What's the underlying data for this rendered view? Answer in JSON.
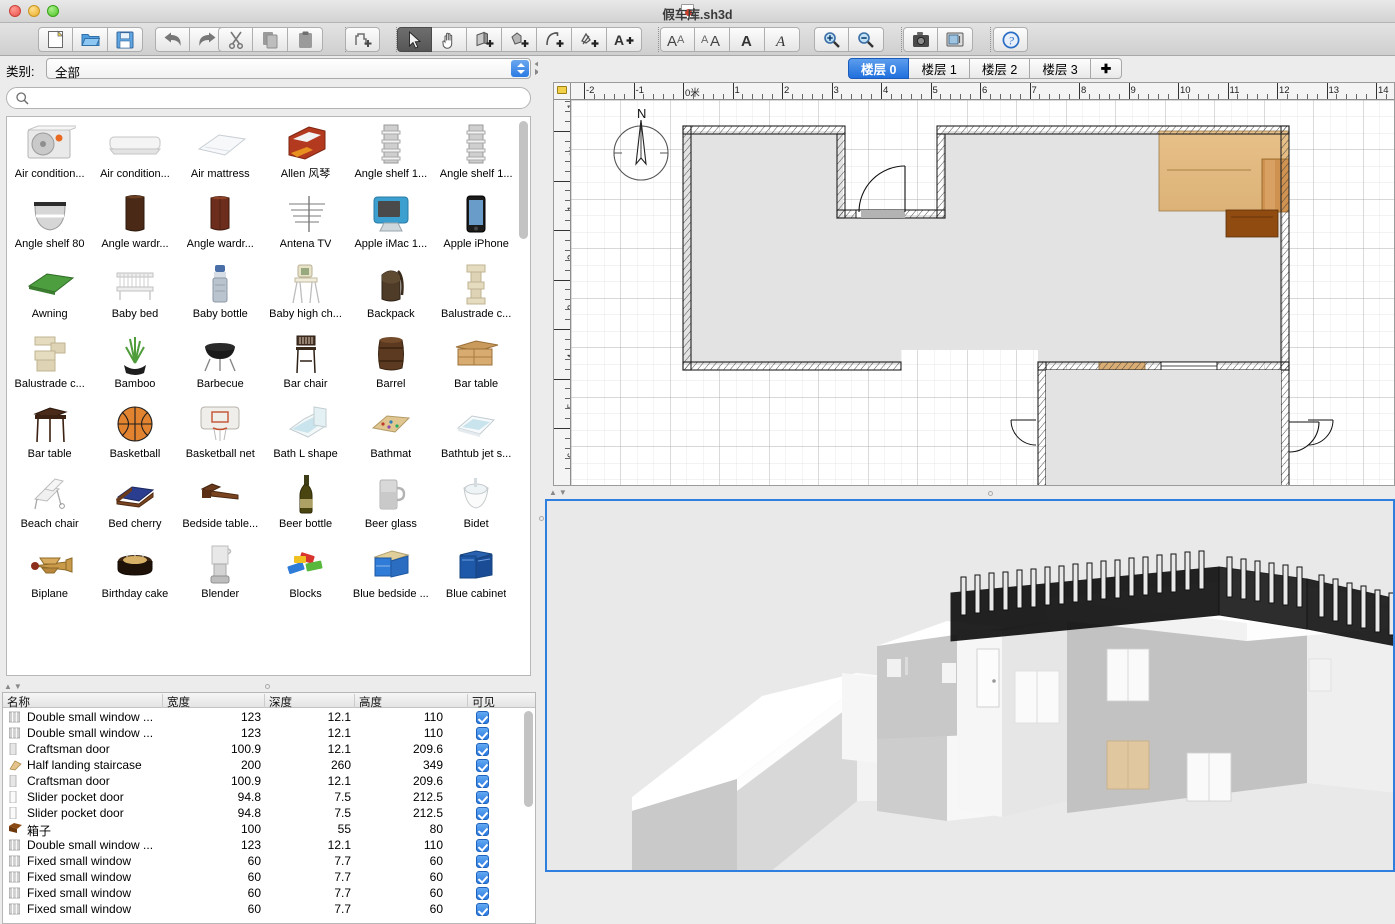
{
  "window": {
    "title": "假车库.sh3d",
    "title_icon": "document-icon",
    "controls": [
      "close",
      "minimize",
      "zoom"
    ]
  },
  "toolbar": {
    "groups": [
      {
        "name": "file",
        "buttons": [
          {
            "name": "new-home-button",
            "icon": "new-document-icon",
            "label": "新建"
          },
          {
            "name": "open-button",
            "icon": "open-folder-icon",
            "label": "打开"
          },
          {
            "name": "save-button",
            "icon": "save-disk-icon",
            "label": "保存"
          }
        ]
      },
      {
        "name": "edit",
        "buttons": [
          {
            "name": "undo-button",
            "icon": "undo-arrow-icon",
            "label": "撤销"
          },
          {
            "name": "redo-button",
            "icon": "redo-arrow-icon",
            "label": "重做"
          }
        ]
      },
      {
        "name": "clipboard",
        "buttons": [
          {
            "name": "cut-button",
            "icon": "scissors-icon",
            "label": "剪切"
          },
          {
            "name": "copy-button",
            "icon": "copy-pages-icon",
            "label": "复制"
          },
          {
            "name": "paste-button",
            "icon": "clipboard-icon",
            "label": "粘贴"
          }
        ]
      },
      {
        "name": "furniture",
        "buttons": [
          {
            "name": "add-furniture-button",
            "icon": "add-furniture-icon",
            "label": "添加家具"
          }
        ]
      },
      {
        "name": "plan-tools",
        "buttons": [
          {
            "name": "select-tool-button",
            "icon": "arrow-pointer-icon",
            "label": "选择",
            "selected": true
          },
          {
            "name": "pan-tool-button",
            "icon": "hand-icon",
            "label": "平移",
            "selected": false
          },
          {
            "name": "create-walls-button",
            "icon": "create-walls-icon",
            "label": "创建墙壁",
            "selected": false
          },
          {
            "name": "create-rooms-button",
            "icon": "create-rooms-icon",
            "label": "创建房间",
            "selected": false
          },
          {
            "name": "create-polyline-button",
            "icon": "create-polyline-icon",
            "label": "创建折线",
            "selected": false
          },
          {
            "name": "create-dimensions-button",
            "icon": "create-dimensions-icon",
            "label": "创建尺寸",
            "selected": false
          },
          {
            "name": "add-text-button",
            "icon": "add-text-icon",
            "label": "添加文字",
            "selected": false
          }
        ]
      },
      {
        "name": "text-style",
        "buttons": [
          {
            "name": "decrease-text-size-button",
            "icon": "text-smaller-icon",
            "label": "缩小文字"
          },
          {
            "name": "increase-text-size-button",
            "icon": "text-larger-icon",
            "label": "放大文字"
          },
          {
            "name": "bold-button",
            "icon": "bold-text-icon",
            "label": "粗体"
          },
          {
            "name": "italic-button",
            "icon": "italic-text-icon",
            "label": "斜体"
          }
        ]
      },
      {
        "name": "zoom",
        "buttons": [
          {
            "name": "zoom-in-button",
            "icon": "magnifier-plus-icon",
            "label": "放大"
          },
          {
            "name": "zoom-out-button",
            "icon": "magnifier-minus-icon",
            "label": "缩小"
          }
        ]
      },
      {
        "name": "photo",
        "buttons": [
          {
            "name": "create-photo-button",
            "icon": "camera-icon",
            "label": "创建照片"
          },
          {
            "name": "create-video-button",
            "icon": "video-icon",
            "label": "创建视频"
          }
        ]
      },
      {
        "name": "help",
        "buttons": [
          {
            "name": "help-button",
            "icon": "question-mark-icon",
            "label": "帮助"
          }
        ]
      }
    ]
  },
  "catalog": {
    "category_label": "类别:",
    "category_value": "全部",
    "search_placeholder": "",
    "search_value": "",
    "search_icon": "search-icon",
    "items": [
      {
        "name": "Air condition...",
        "icon": "air-conditioner-outdoor"
      },
      {
        "name": "Air condition...",
        "icon": "air-conditioner-indoor"
      },
      {
        "name": "Air mattress",
        "icon": "air-mattress"
      },
      {
        "name": "Allen 风琴",
        "icon": "organ"
      },
      {
        "name": "Angle shelf 1...",
        "icon": "angle-shelf"
      },
      {
        "name": "Angle shelf 1...",
        "icon": "angle-shelf"
      },
      {
        "name": "Angle shelf 80",
        "icon": "angle-shelf-80"
      },
      {
        "name": "Angle wardr...",
        "icon": "angle-wardrobe-dark"
      },
      {
        "name": "Angle wardr...",
        "icon": "angle-wardrobe-red"
      },
      {
        "name": "Antena TV",
        "icon": "tv-antenna"
      },
      {
        "name": "Apple iMac 1...",
        "icon": "imac"
      },
      {
        "name": "Apple iPhone",
        "icon": "iphone"
      },
      {
        "name": "Awning",
        "icon": "awning"
      },
      {
        "name": "Baby bed",
        "icon": "baby-bed"
      },
      {
        "name": "Baby bottle",
        "icon": "baby-bottle"
      },
      {
        "name": "Baby high ch...",
        "icon": "baby-high-chair"
      },
      {
        "name": "Backpack",
        "icon": "backpack"
      },
      {
        "name": "Balustrade c...",
        "icon": "balustrade-column"
      },
      {
        "name": "Balustrade c...",
        "icon": "balustrade-corner"
      },
      {
        "name": "Bamboo",
        "icon": "bamboo"
      },
      {
        "name": "Barbecue",
        "icon": "barbecue"
      },
      {
        "name": "Bar chair",
        "icon": "bar-chair"
      },
      {
        "name": "Barrel",
        "icon": "barrel"
      },
      {
        "name": "Bar table",
        "icon": "bar-table-wood"
      },
      {
        "name": "Bar table",
        "icon": "bar-table-dark"
      },
      {
        "name": "Basketball",
        "icon": "basketball"
      },
      {
        "name": "Basketball net",
        "icon": "basketball-net"
      },
      {
        "name": "Bath L shape",
        "icon": "bath-l-shape"
      },
      {
        "name": "Bathmat",
        "icon": "bathmat"
      },
      {
        "name": "Bathtub jet s...",
        "icon": "bathtub-jet"
      },
      {
        "name": "Beach chair",
        "icon": "beach-chair"
      },
      {
        "name": "Bed cherry",
        "icon": "bed-cherry"
      },
      {
        "name": "Bedside table...",
        "icon": "bedside-table"
      },
      {
        "name": "Beer bottle",
        "icon": "beer-bottle"
      },
      {
        "name": "Beer glass",
        "icon": "beer-glass"
      },
      {
        "name": "Bidet",
        "icon": "bidet"
      },
      {
        "name": "Biplane",
        "icon": "biplane"
      },
      {
        "name": "Birthday cake",
        "icon": "birthday-cake"
      },
      {
        "name": "Blender",
        "icon": "blender"
      },
      {
        "name": "Blocks",
        "icon": "blocks"
      },
      {
        "name": "Blue bedside ...",
        "icon": "blue-bedside-table"
      },
      {
        "name": "Blue cabinet",
        "icon": "blue-cabinet"
      }
    ]
  },
  "furniture_list": {
    "columns": [
      {
        "name": "名称",
        "key": "name"
      },
      {
        "name": "宽度",
        "key": "width"
      },
      {
        "name": "深度",
        "key": "depth"
      },
      {
        "name": "高度",
        "key": "height"
      },
      {
        "name": "可见",
        "key": "visible"
      }
    ],
    "rows": [
      {
        "icon": "window-icon",
        "name": "Double small window ...",
        "width": "123",
        "depth": "12.1",
        "height": "110",
        "visible": true
      },
      {
        "icon": "window-icon",
        "name": "Double small window ...",
        "width": "123",
        "depth": "12.1",
        "height": "110",
        "visible": true
      },
      {
        "icon": "door-icon",
        "name": "Craftsman door",
        "width": "100.9",
        "depth": "12.1",
        "height": "209.6",
        "visible": true
      },
      {
        "icon": "staircase-icon",
        "name": "Half landing staircase",
        "width": "200",
        "depth": "260",
        "height": "349",
        "visible": true
      },
      {
        "icon": "door-icon",
        "name": "Craftsman door",
        "width": "100.9",
        "depth": "12.1",
        "height": "209.6",
        "visible": true
      },
      {
        "icon": "slider-door-icon",
        "name": "Slider pocket door",
        "width": "94.8",
        "depth": "7.5",
        "height": "212.5",
        "visible": true
      },
      {
        "icon": "slider-door-icon",
        "name": "Slider pocket door",
        "width": "94.8",
        "depth": "7.5",
        "height": "212.5",
        "visible": true
      },
      {
        "icon": "box-icon",
        "name": "箱子",
        "width": "100",
        "depth": "55",
        "height": "80",
        "visible": true
      },
      {
        "icon": "window-icon",
        "name": "Double small window ...",
        "width": "123",
        "depth": "12.1",
        "height": "110",
        "visible": true
      },
      {
        "icon": "window-icon",
        "name": "Fixed small window",
        "width": "60",
        "depth": "7.7",
        "height": "60",
        "visible": true
      },
      {
        "icon": "window-icon",
        "name": "Fixed small window",
        "width": "60",
        "depth": "7.7",
        "height": "60",
        "visible": true
      },
      {
        "icon": "window-icon",
        "name": "Fixed small window",
        "width": "60",
        "depth": "7.7",
        "height": "60",
        "visible": true
      },
      {
        "icon": "window-icon",
        "name": "Fixed small window",
        "width": "60",
        "depth": "7.7",
        "height": "60",
        "visible": true
      }
    ]
  },
  "plan": {
    "floor_tabs": [
      {
        "label": "楼层 0",
        "active": true
      },
      {
        "label": "楼层 1",
        "active": false
      },
      {
        "label": "楼层 2",
        "active": false
      },
      {
        "label": "楼层 3",
        "active": false
      }
    ],
    "add_floor_label": "✚",
    "ruler_unit_label": "0米",
    "h_ruler_labels": [
      "-2",
      "-1",
      "0米",
      "1",
      "2",
      "3",
      "4",
      "5",
      "6",
      "7",
      "8",
      "9",
      "10",
      "11",
      "12",
      "13",
      "14"
    ],
    "v_ruler_labels": [
      "-1",
      "0米",
      "1",
      "2",
      "3",
      "4",
      "5",
      "6"
    ],
    "compass_label": "N",
    "lock_icon": "padlock-icon"
  },
  "view3d": {
    "nav_pad_icon": "four-way-arrows-icon",
    "selected_border_color": "#2f7fe0"
  },
  "colors": {
    "accent": "#2a7ae0",
    "selected_tab": "#1f6fdd",
    "wall_fill": "#e2e2e2",
    "wood_light": "#e3bd86",
    "wood_dark": "#8a4a14"
  }
}
